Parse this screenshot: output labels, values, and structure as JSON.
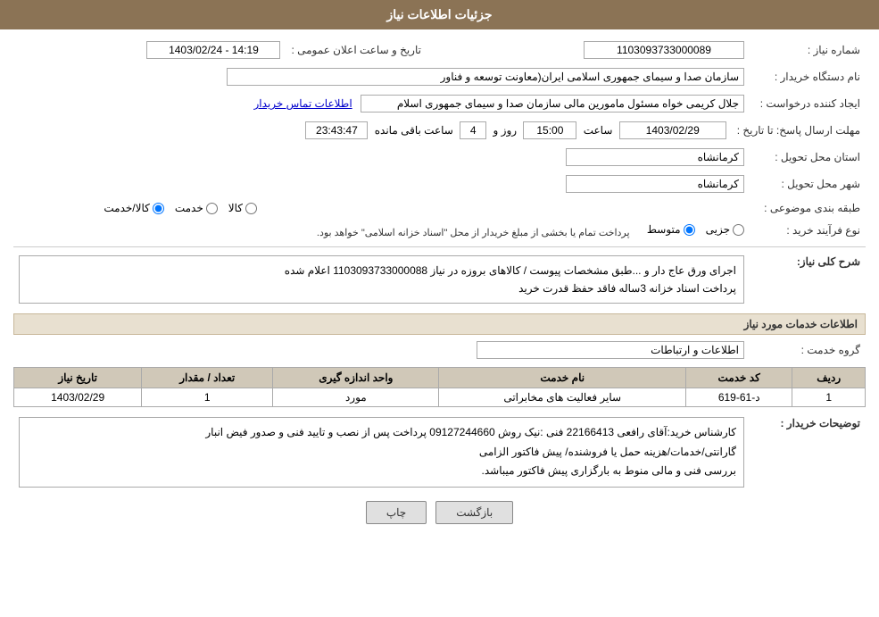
{
  "header": {
    "title": "جزئیات اطلاعات نیاز"
  },
  "fields": {
    "need_number_label": "شماره نیاز :",
    "need_number_value": "1103093733000089",
    "announce_datetime_label": "تاریخ و ساعت اعلان عمومی :",
    "announce_datetime_value": "1403/02/24 - 14:19",
    "buyer_org_label": "نام دستگاه خریدار :",
    "buyer_org_value": "سازمان صدا و سیمای جمهوری اسلامی ایران(معاونت توسعه و فناور",
    "creator_label": "ایجاد کننده درخواست :",
    "creator_value": "جلال کریمی خواه مسئول مامورین مالی  سازمان صدا و سیمای جمهوری اسلام",
    "creator_link": "اطلاعات تماس خریدار",
    "response_deadline_label": "مهلت ارسال پاسخ: تا تاریخ :",
    "response_date_value": "1403/02/29",
    "response_time_label": "ساعت",
    "response_time_value": "15:00",
    "remaining_days_label": "روز و",
    "remaining_days_value": "4",
    "remaining_time_label": "ساعت باقی مانده",
    "remaining_time_value": "23:43:47",
    "province_label": "استان محل تحویل :",
    "province_value": "کرمانشاه",
    "city_label": "شهر محل تحویل :",
    "city_value": "کرمانشاه",
    "category_label": "طبقه بندی موضوعی :",
    "category_options": [
      "کالا",
      "خدمت",
      "کالا/خدمت"
    ],
    "category_selected": "کالا/خدمت",
    "purchase_type_label": "نوع فرآیند خرید :",
    "purchase_type_note": "پرداخت تمام یا بخشی از مبلغ خریدار از محل \"اسناد خزانه اسلامی\" خواهد بود.",
    "purchase_options": [
      "جزیی",
      "متوسط"
    ],
    "purchase_selected": "متوسط"
  },
  "need_description": {
    "section_title": "شرح کلی نیاز:",
    "text_line1": "اجرای ورق عاج دار و ...طبق مشخصات پیوست / کالاهای بروزه در نیاز 1103093733000088 اعلام شده",
    "text_line2": "پرداخت اسناد خزانه 3ساله فاقد حفظ قدرت خرید"
  },
  "service_info": {
    "section_title": "اطلاعات خدمات مورد نیاز",
    "group_label": "گروه خدمت :",
    "group_value": "اطلاعات و ارتباطات",
    "table_headers": [
      "ردیف",
      "کد خدمت",
      "نام خدمت",
      "واحد اندازه گیری",
      "تعداد / مقدار",
      "تاریخ نیاز"
    ],
    "table_rows": [
      {
        "row": "1",
        "code": "د-61-619",
        "name": "سایر فعالیت های مخابراتی",
        "unit": "مورد",
        "quantity": "1",
        "date": "1403/02/29"
      }
    ]
  },
  "buyer_notes": {
    "section_title": "توضیحات خریدار :",
    "text": "کارشناس خرید:آقای رافعی 22166413  فنی :نیک روش 09127244660 پرداخت پس از نصب و تایید فنی و صدور فیض انبار\nگارانتی/خدمات/هزینه حمل یا فروشنده/ پیش فاکتور الزامی\nبررسی فنی و مالی منوط به بارگزاری پیش فاکتور میباشد."
  },
  "buttons": {
    "print_label": "چاپ",
    "back_label": "بازگشت"
  }
}
